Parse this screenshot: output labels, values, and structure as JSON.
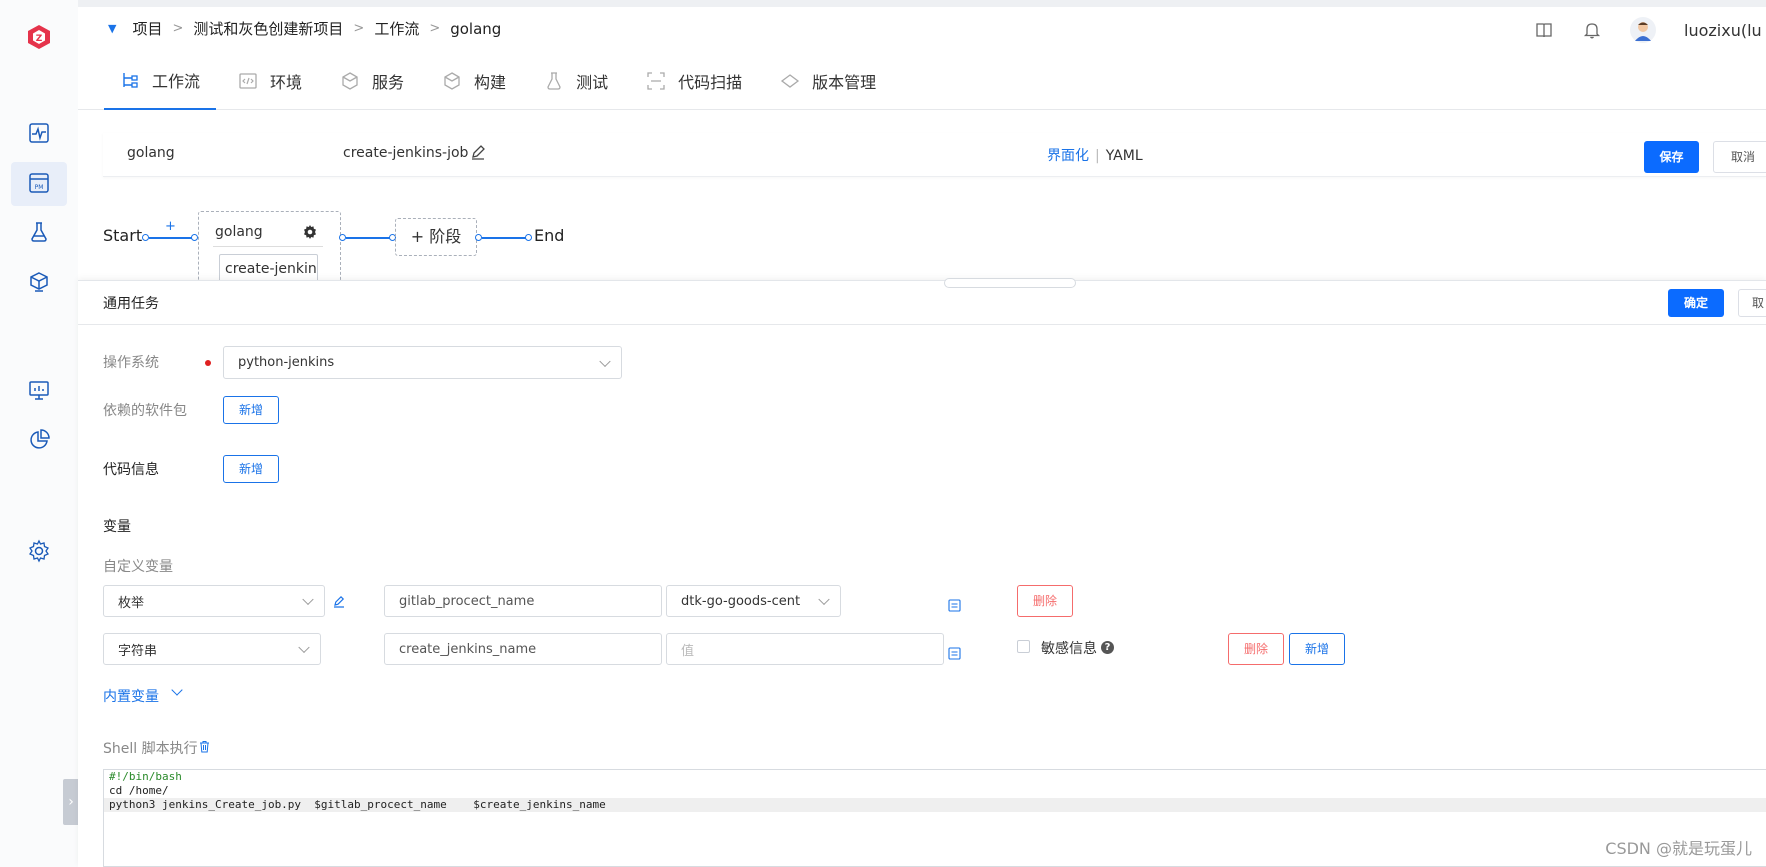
{
  "breadcrumb": [
    "项目",
    "测试和灰色创建新项目",
    "工作流",
    "golang"
  ],
  "breadcrumb_sep": ">",
  "user": {
    "name": "luozixu(lu"
  },
  "tabs": [
    {
      "label": "工作流",
      "active": true
    },
    {
      "label": "环境"
    },
    {
      "label": "服务"
    },
    {
      "label": "构建"
    },
    {
      "label": "测试"
    },
    {
      "label": "代码扫描"
    },
    {
      "label": "版本管理"
    }
  ],
  "workflow": {
    "name": "golang",
    "job": "create-jenkins-job",
    "mode_visual": "界面化",
    "mode_yaml": "YAML",
    "save": "保存",
    "cancel": "取消"
  },
  "pipeline": {
    "start": "Start",
    "end": "End",
    "plus": "+",
    "stage_name": "golang",
    "stage_job": "create-jenkins",
    "add_stage": "+ 阶段"
  },
  "panel": {
    "title": "通用任务",
    "confirm": "确定",
    "cancel": "取"
  },
  "form": {
    "os_label": "操作系统",
    "os_value": "python-jenkins",
    "deps_label": "依赖的软件包",
    "deps_add": "新增",
    "code_label": "代码信息",
    "code_add": "新增",
    "vars_title": "变量",
    "custom_vars": "自定义变量",
    "var_rows": [
      {
        "type": "枚举",
        "key": "gitlab_procect_name",
        "value": "dtk-go-goods-cent",
        "delete": "删除"
      },
      {
        "type": "字符串",
        "key": "create_jenkins_name",
        "value_placeholder": "值",
        "sensitive": "敏感信息",
        "delete": "删除",
        "add": "新增"
      }
    ],
    "builtin_vars": "内置变量",
    "shell_label": "Shell 脚本执行"
  },
  "script": [
    "#!/bin/bash",
    "cd /home/",
    "python3 jenkins_Create_job.py  $gitlab_procect_name    $create_jenkins_name"
  ],
  "watermark": "CSDN @就是玩蛋儿",
  "colors": {
    "primary": "#0b6bff",
    "danger": "#f56c6c",
    "brand": "#e5334b"
  }
}
